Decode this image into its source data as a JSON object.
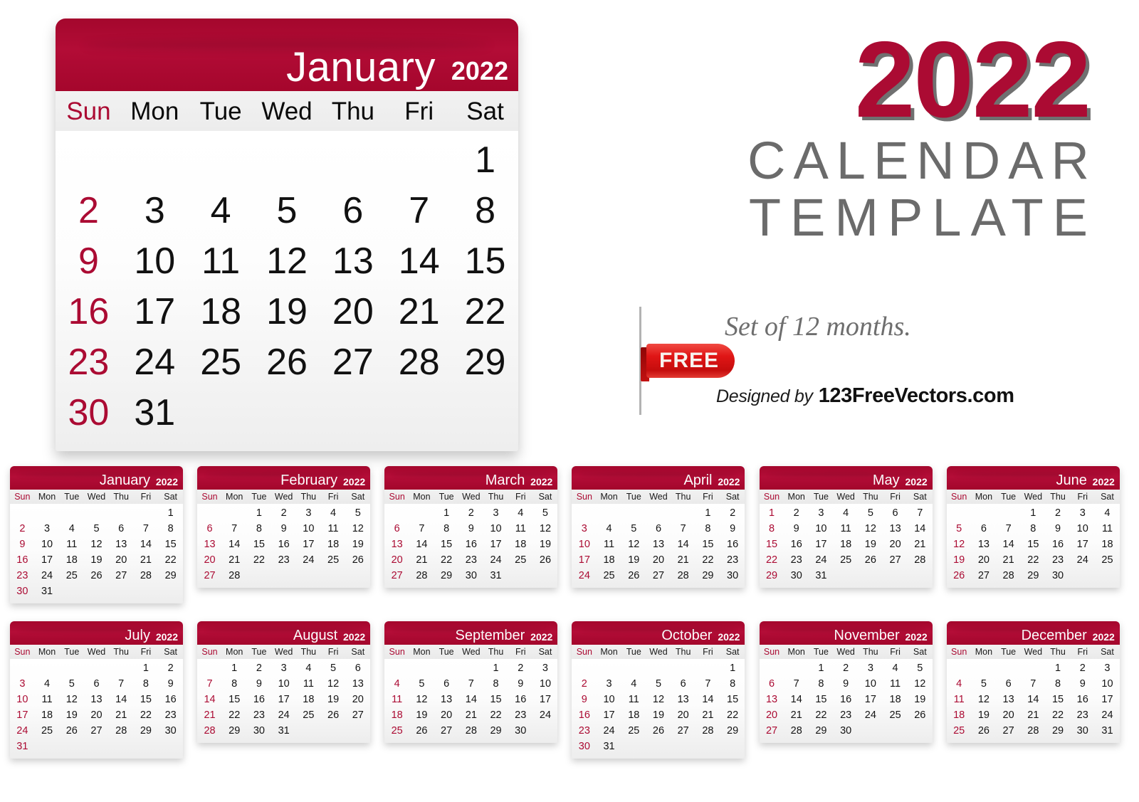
{
  "brand": {
    "accent_red": "#ab0b33",
    "free_red": "#e01616",
    "gray_text": "#6b6b6b"
  },
  "title": {
    "year": "2022",
    "line1": "CALENDAR",
    "line2": "TEMPLATE",
    "subtitle": "Set of 12 months.",
    "badge": "FREE",
    "designed_by": "Designed by",
    "site": "123FreeVectors.com"
  },
  "weekdays": [
    "Sun",
    "Mon",
    "Tue",
    "Wed",
    "Thu",
    "Fri",
    "Sat"
  ],
  "hero": {
    "month": "January",
    "year": "2022",
    "lead_blanks": 6,
    "days": 31
  },
  "months": [
    {
      "name": "January",
      "year": "2022",
      "lead_blanks": 6,
      "days": 31
    },
    {
      "name": "February",
      "year": "2022",
      "lead_blanks": 2,
      "days": 28
    },
    {
      "name": "March",
      "year": "2022",
      "lead_blanks": 2,
      "days": 31
    },
    {
      "name": "April",
      "year": "2022",
      "lead_blanks": 5,
      "days": 30
    },
    {
      "name": "May",
      "year": "2022",
      "lead_blanks": 0,
      "days": 31
    },
    {
      "name": "June",
      "year": "2022",
      "lead_blanks": 3,
      "days": 30
    },
    {
      "name": "July",
      "year": "2022",
      "lead_blanks": 5,
      "days": 31
    },
    {
      "name": "August",
      "year": "2022",
      "lead_blanks": 1,
      "days": 31
    },
    {
      "name": "September",
      "year": "2022",
      "lead_blanks": 4,
      "days": 30
    },
    {
      "name": "October",
      "year": "2022",
      "lead_blanks": 6,
      "days": 31
    },
    {
      "name": "November",
      "year": "2022",
      "lead_blanks": 2,
      "days": 30
    },
    {
      "name": "December",
      "year": "2022",
      "lead_blanks": 4,
      "days": 31
    }
  ]
}
